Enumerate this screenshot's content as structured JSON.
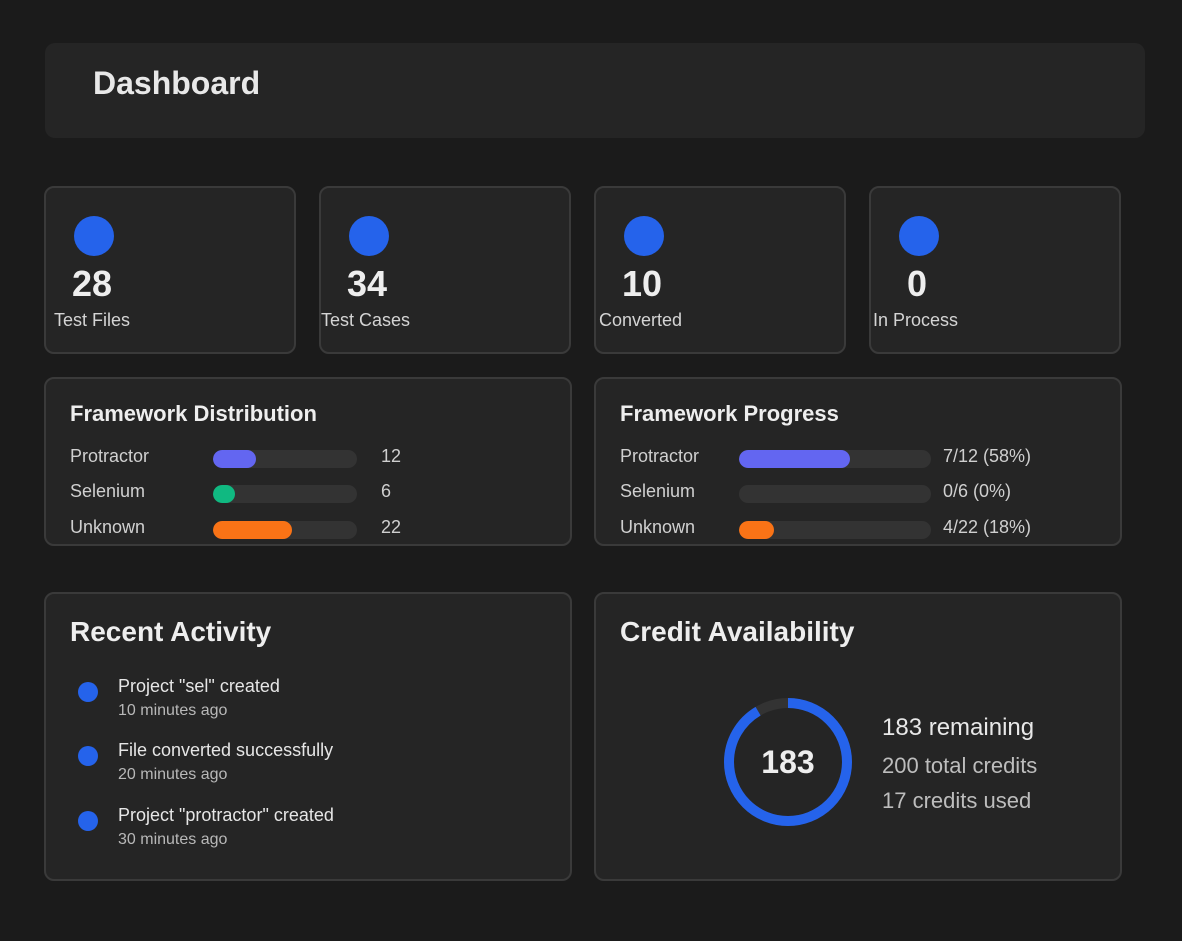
{
  "header": {
    "title": "Dashboard"
  },
  "colors": {
    "accent": "#2563eb",
    "protractor": "#6366f1",
    "selenium": "#10b981",
    "unknown": "#f97316",
    "track": "#333333"
  },
  "stats": [
    {
      "value": "28",
      "label": "Test Files",
      "icon": "circle-icon"
    },
    {
      "value": "34",
      "label": "Test Cases",
      "icon": "circle-icon"
    },
    {
      "value": "10",
      "label": "Converted",
      "icon": "circle-icon"
    },
    {
      "value": "0",
      "label": "In Process",
      "icon": "circle-icon"
    }
  ],
  "distribution": {
    "title": "Framework Distribution",
    "max": 40,
    "rows": [
      {
        "name": "Protractor",
        "value": 12,
        "value_label": "12"
      },
      {
        "name": "Selenium",
        "value": 6,
        "value_label": "6"
      },
      {
        "name": "Unknown",
        "value": 22,
        "value_label": "22"
      }
    ]
  },
  "progress": {
    "title": "Framework Progress",
    "rows": [
      {
        "name": "Protractor",
        "fraction": 0.58,
        "value_label": "7/12 (58%)"
      },
      {
        "name": "Selenium",
        "fraction": 0.0,
        "value_label": "0/6 (0%)"
      },
      {
        "name": "Unknown",
        "fraction": 0.18,
        "value_label": "4/22 (18%)"
      }
    ]
  },
  "activity": {
    "title": "Recent Activity",
    "items": [
      {
        "text": "Project \"sel\" created",
        "time": "10 minutes ago"
      },
      {
        "text": "File converted successfully",
        "time": "20 minutes ago"
      },
      {
        "text": "Project \"protractor\" created",
        "time": "30 minutes ago"
      }
    ]
  },
  "credits": {
    "title": "Credit Availability",
    "remaining_value": 183,
    "total_value": 200,
    "ring_label": "183",
    "remaining_text": "183 remaining",
    "total_text": "200 total credits",
    "used_text": "17 credits used"
  }
}
